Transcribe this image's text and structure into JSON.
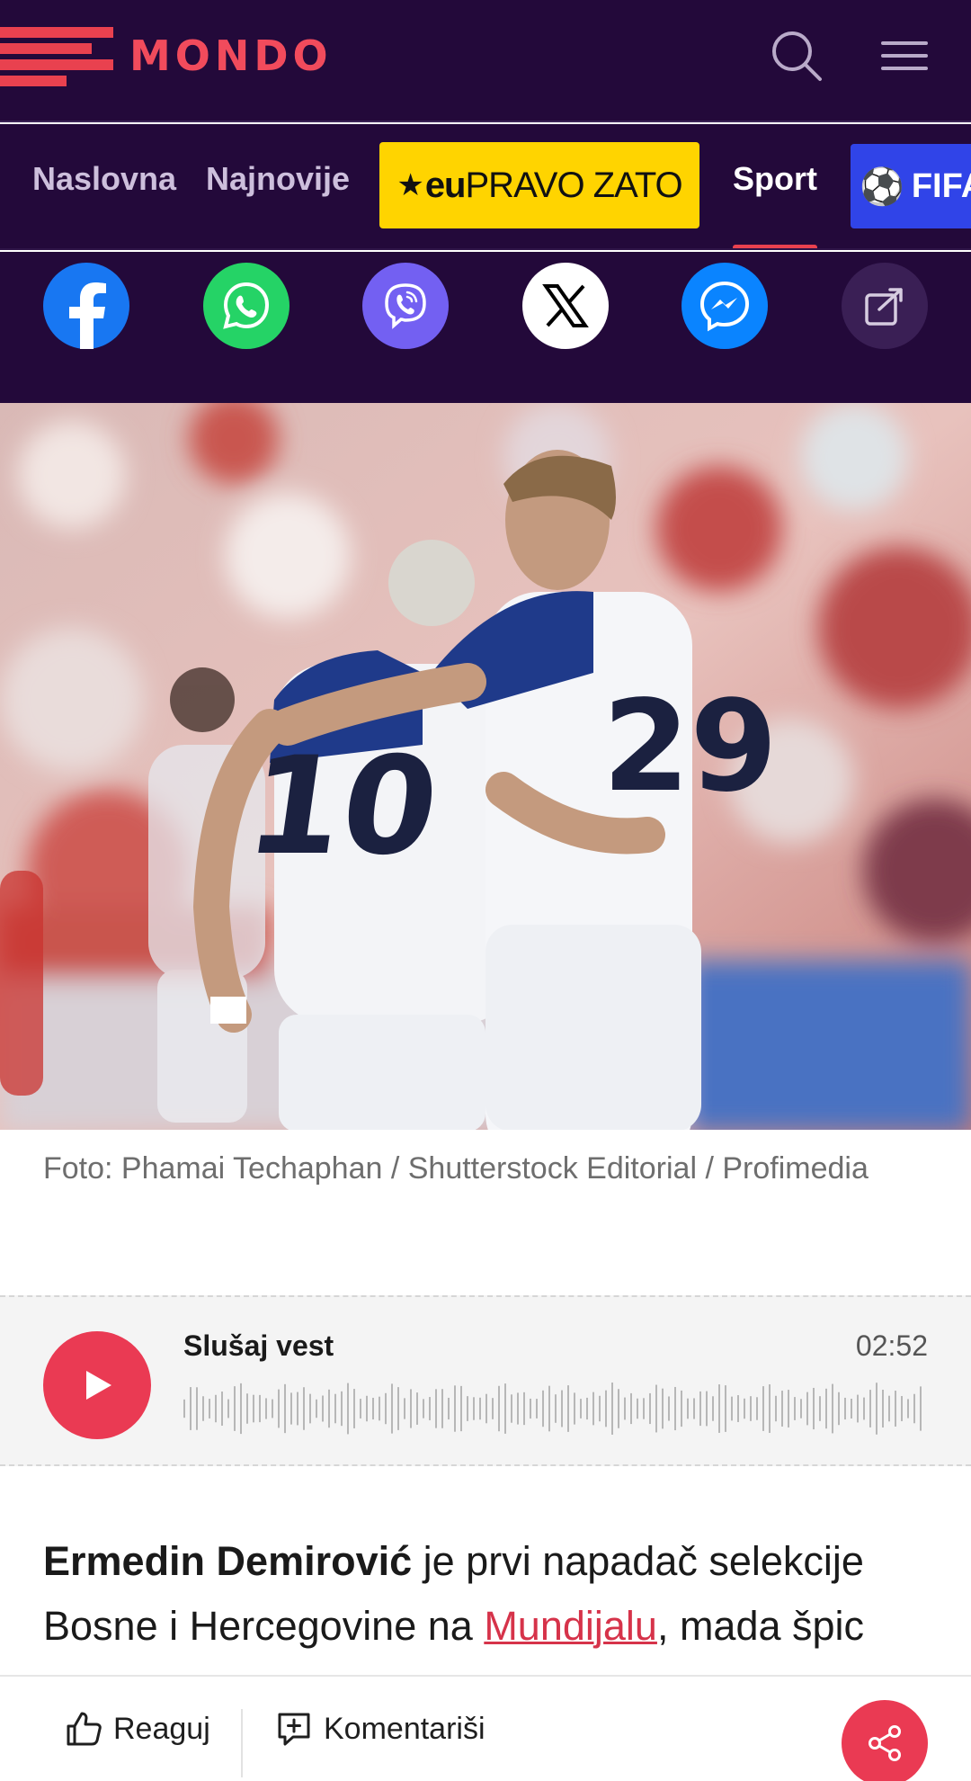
{
  "header": {
    "logo_text": "MONDO",
    "brand_color": "#e9414f",
    "background": "#23093a"
  },
  "nav": {
    "items": [
      {
        "label": "Naslovna"
      },
      {
        "label": "Najnovije"
      },
      {
        "label": "Sport",
        "active": true
      }
    ],
    "promo": {
      "prefix": "eu",
      "label": "PRAVO ZATO"
    },
    "fifa": {
      "label": "FIFA"
    }
  },
  "share": {
    "buttons": [
      {
        "name": "facebook",
        "color": "#1877f2"
      },
      {
        "name": "whatsapp",
        "color": "#25d366"
      },
      {
        "name": "viber",
        "color": "#7360f2"
      },
      {
        "name": "x",
        "color": "#ffffff"
      },
      {
        "name": "messenger",
        "color": "#0a84ff"
      },
      {
        "name": "copy-link",
        "color": "#3a1f55"
      }
    ]
  },
  "photo": {
    "caption": "Foto: Phamai Techaphan / Shutterstock Editorial / Profimedia",
    "jersey_numbers": [
      "10",
      "29"
    ]
  },
  "audio": {
    "title": "Slušaj vest",
    "duration": "02:52"
  },
  "article": {
    "bold_name": "Ermedin Demirović",
    "text_1": " je prvi napadač selekcije Bosne i Hercegovine na ",
    "link_text": "Mundijalu",
    "text_2": ", mada špic"
  },
  "bottom_bar": {
    "react_label": "Reaguj",
    "comment_label": "Komentariši"
  }
}
